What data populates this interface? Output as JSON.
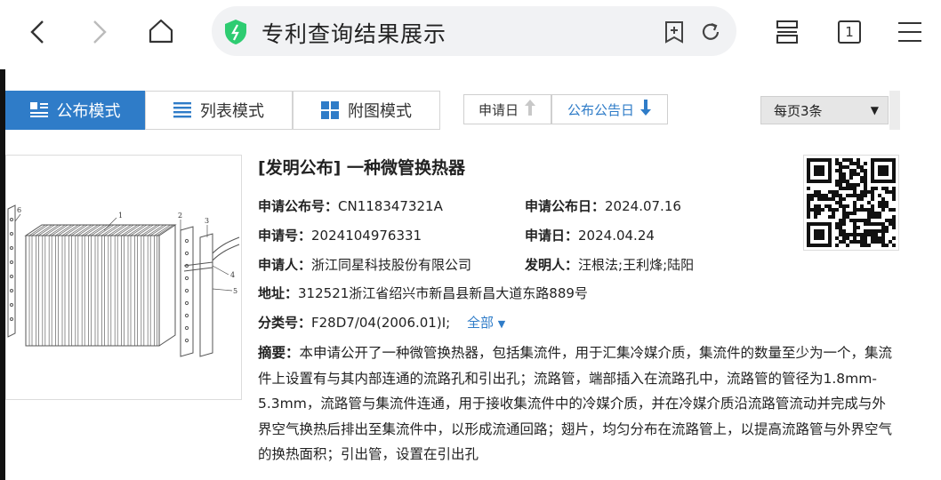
{
  "browser": {
    "page_title": "专利查询结果展示",
    "tab_count": "1"
  },
  "modes": [
    {
      "label": "公布模式",
      "active": true
    },
    {
      "label": "列表模式",
      "active": false
    },
    {
      "label": "附图模式",
      "active": false
    }
  ],
  "sort": {
    "apply_date": "申请日",
    "pub_date": "公布公告日"
  },
  "perpage": "每页3条",
  "record": {
    "title": "[发明公布] 一种微管换热器",
    "pub_no_label": "申请公布号：",
    "pub_no": "CN118347321A",
    "pub_date_label": "申请公布日：",
    "pub_date": "2024.07.16",
    "app_no_label": "申请号：",
    "app_no": "2024104976331",
    "app_date_label": "申请日：",
    "app_date": "2024.04.24",
    "applicant_label": "申请人：",
    "applicant": "浙江同星科技股份有限公司",
    "inventor_label": "发明人：",
    "inventor": "汪根法;王利烽;陆阳",
    "address_label": "地址：",
    "address": "312521浙江省绍兴市新昌县新昌大道东路889号",
    "class_label": "分类号：",
    "class_no": "F28D7/04(2006.01)I;",
    "all_label": "全部",
    "abstract_label": "摘要：",
    "abstract_text": "本申请公开了一种微管换热器，包括集流件，用于汇集冷媒介质，集流件的数量至少为一个，集流件上设置有与其内部连通的流路孔和引出孔；流路管，端部插入在流路孔中，流路管的管径为1.8mm-5.3mm，流路管与集流件连通，用于接收集流件中的冷媒介质，并在冷媒介质沿流路管流动并完成与外界空气换热后排出至集流件中，以形成流通回路；翅片，均匀分布在流路管上，以提高流路管与外界空气的换热面积；引出管，设置在引出孔"
  },
  "figure_labels": [
    "1",
    "2",
    "3",
    "4",
    "5",
    "6"
  ]
}
